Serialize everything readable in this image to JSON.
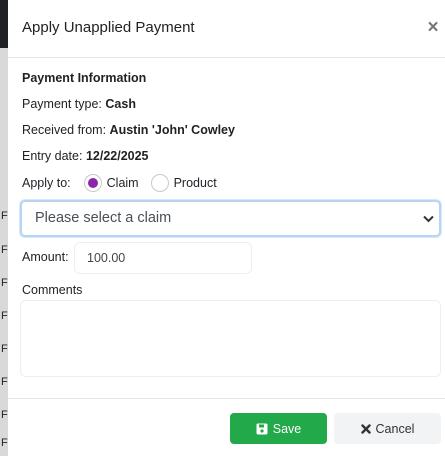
{
  "background_page": {
    "row_stub": "F"
  },
  "modal": {
    "title": "Apply Unapplied Payment",
    "close_glyph": "×"
  },
  "payment_info": {
    "section_title": "Payment Information",
    "payment_type_label": "Payment type:",
    "payment_type_value": "Cash",
    "received_from_label": "Received from:",
    "received_from_value": "Austin 'John' Cowley",
    "entry_date_label": "Entry date:",
    "entry_date_value": "12/22/2025"
  },
  "apply_to": {
    "label": "Apply to:",
    "options": [
      {
        "label": "Claim",
        "selected": true
      },
      {
        "label": "Product",
        "selected": false
      }
    ]
  },
  "claim_select": {
    "selected_text": "Please select a claim",
    "icon": "chevron-down-icon"
  },
  "amount": {
    "label": "Amount:",
    "value": "100.00"
  },
  "comments": {
    "label": "Comments",
    "value": ""
  },
  "footer": {
    "save_label": "Save",
    "save_icon": "save-icon",
    "cancel_label": "Cancel",
    "cancel_icon": "close-icon"
  },
  "colors": {
    "radio_selected": "#8e24aa",
    "save_button": "#22a949",
    "select_focus_border": "#b8d4f3"
  }
}
